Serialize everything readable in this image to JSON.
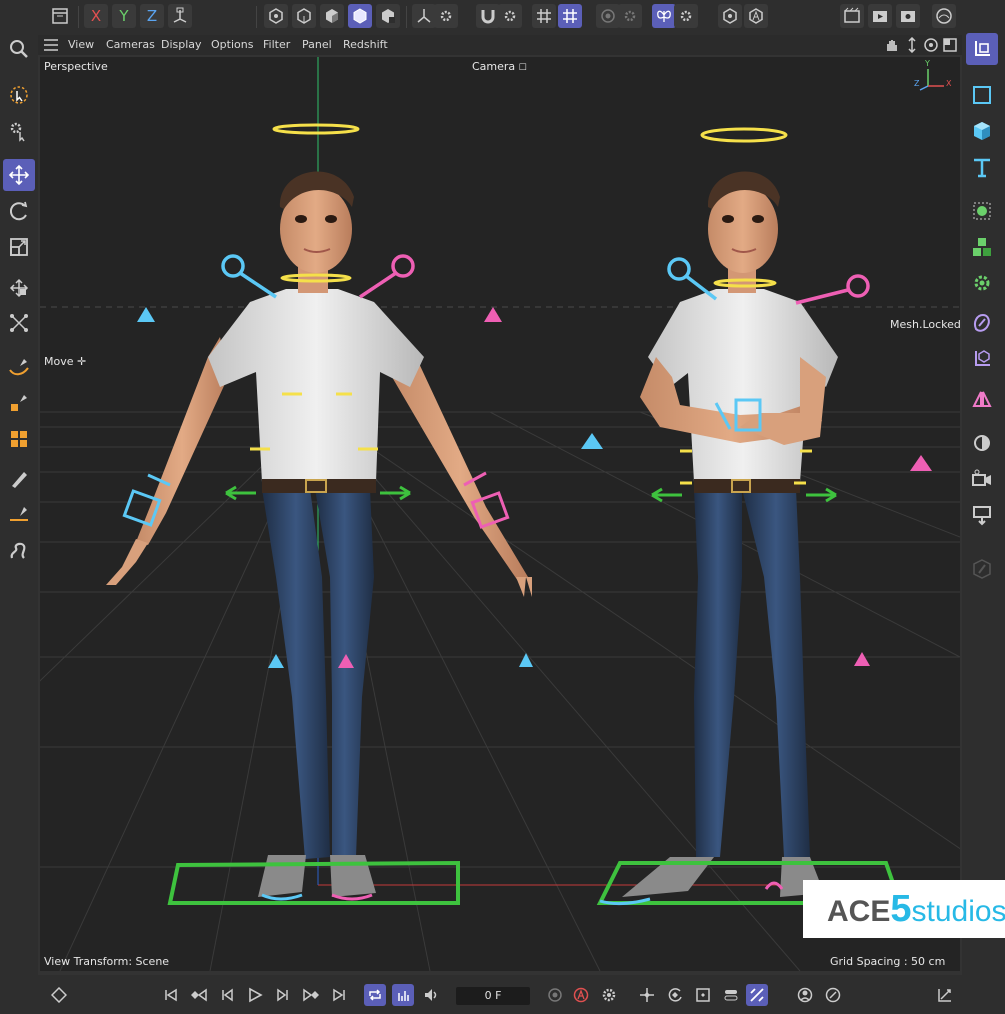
{
  "menubar": {
    "items": [
      "View",
      "Cameras",
      "Display",
      "Options",
      "Filter",
      "Panel",
      "Redshift"
    ]
  },
  "viewport": {
    "name": "Perspective",
    "camera_label": "Camera",
    "tool_label": "Move",
    "status_label": "Mesh.Locked",
    "view_transform": "View Transform: Scene",
    "grid_spacing": "Grid Spacing : 50 cm",
    "axis_labels": {
      "x": "X",
      "y": "Y",
      "z": "Z"
    }
  },
  "toolbar": {
    "axis_x": "X",
    "axis_y": "Y",
    "axis_z": "Z"
  },
  "timeline": {
    "current_frame": "0 F"
  },
  "logo": {
    "ace": "ACE",
    "five": "5",
    "studios": "studios"
  },
  "colors": {
    "accent": "#5b5fb8",
    "control_cyan": "#5bc8f5",
    "control_pink": "#ee5fb4",
    "control_yellow": "#f5e04a",
    "control_green": "#3ec23e"
  }
}
